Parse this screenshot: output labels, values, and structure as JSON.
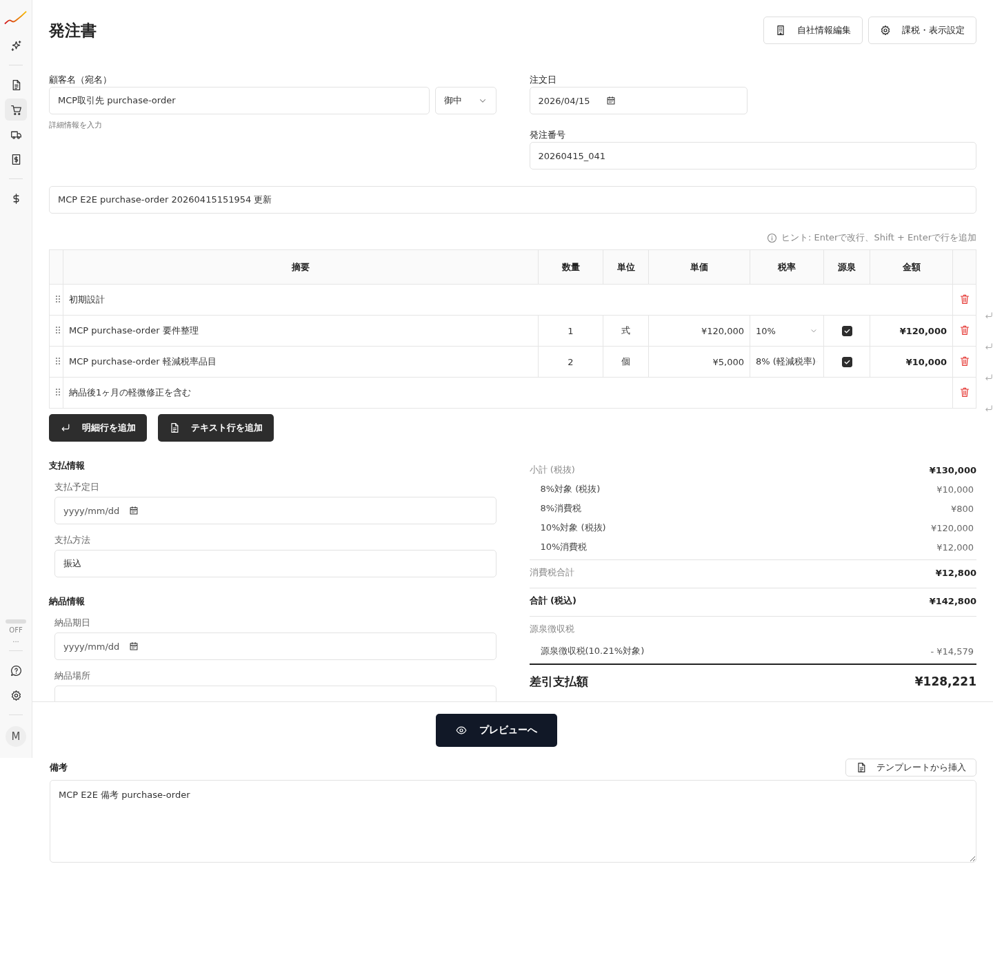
{
  "sidebar": {
    "top_items": [
      {
        "kind": "sparkle",
        "selected": false
      }
    ],
    "nav_items": [
      {
        "kind": "document",
        "selected": false
      },
      {
        "kind": "cart",
        "selected": true
      },
      {
        "kind": "truck",
        "selected": false
      },
      {
        "kind": "receipt",
        "selected": false
      }
    ],
    "extra_items": [
      {
        "kind": "dollar",
        "selected": false
      }
    ],
    "toggle": {
      "label": "OFF",
      "on": false
    },
    "more": "...",
    "bottom_items": [
      {
        "kind": "help"
      },
      {
        "kind": "settings"
      }
    ],
    "avatar": "M"
  },
  "page": {
    "title": "発注書",
    "actions": [
      {
        "kind": "building",
        "label": "自社情報編集"
      },
      {
        "kind": "gear",
        "label": "課税・表示設定"
      }
    ]
  },
  "customer": {
    "label": "顧客名（宛名）",
    "value": "MCP取引先 purchase-order",
    "honorific": "御中",
    "details_link": "詳細情報を入力"
  },
  "order_date": {
    "label": "注文日",
    "value": "2026/04/15"
  },
  "order_number": {
    "label": "発注番号",
    "value": "20260415_041"
  },
  "subject": {
    "value": "MCP E2E purchase-order 20260415151954 更新"
  },
  "hint": "ヒント: Enterで改行、Shift + Enterで行を追加",
  "table": {
    "columns": [
      "摘要",
      "数量",
      "単位",
      "単価",
      "税率",
      "源泉",
      "金額"
    ],
    "rows": [
      {
        "kind": "text",
        "description": "初期設計"
      },
      {
        "kind": "item",
        "description": "MCP purchase-order 要件整理",
        "quantity": "1",
        "unit": "式",
        "unit_price": "¥120,000",
        "tax_rate": "10%",
        "withholding": true,
        "amount": "¥120,000"
      },
      {
        "kind": "item",
        "description": "MCP purchase-order 軽減税率品目",
        "quantity": "2",
        "unit": "個",
        "unit_price": "¥5,000",
        "tax_rate": "8% (軽減税率)",
        "withholding": true,
        "amount": "¥10,000"
      },
      {
        "kind": "text",
        "description": "納品後1ヶ月の軽微修正を含む"
      }
    ]
  },
  "row_buttons": [
    {
      "kind": "return",
      "label": "明細行を追加"
    },
    {
      "kind": "document",
      "label": "テキスト行を追加"
    }
  ],
  "payment": {
    "heading": "支払情報",
    "fields": [
      {
        "kind": "date",
        "label": "支払予定日",
        "placeholder": "yyyy/mm/dd"
      },
      {
        "kind": "text",
        "label": "支払方法",
        "value": "振込"
      }
    ]
  },
  "delivery": {
    "heading": "納品情報",
    "fields": [
      {
        "kind": "date",
        "label": "納品期日",
        "placeholder": "yyyy/mm/dd"
      },
      {
        "kind": "text",
        "label": "納品場所"
      }
    ]
  },
  "summary": {
    "rows": [
      {
        "kind": "main",
        "label": "小計 (税抜)",
        "value": "¥130,000"
      },
      {
        "kind": "sub",
        "label": "8%対象 (税抜)",
        "value": "¥10,000"
      },
      {
        "kind": "sub",
        "label": "8%消費税",
        "value": "¥800"
      },
      {
        "kind": "sub",
        "label": "10%対象 (税抜)",
        "value": "¥120,000"
      },
      {
        "kind": "sub",
        "label": "10%消費税",
        "value": "¥12,000"
      },
      {
        "kind": "main_divided",
        "label": "消費税合計",
        "value": "¥12,800"
      },
      {
        "kind": "strong_divided",
        "label": "合計 (税込)",
        "value": "¥142,800"
      },
      {
        "kind": "heading_divided",
        "label": "源泉徴収税"
      },
      {
        "kind": "sub",
        "label": "源泉徴収税(10.21%対象)",
        "value": "- ¥14,579"
      }
    ],
    "total": {
      "label": "差引支払額",
      "value": "¥128,221"
    }
  },
  "footer": {
    "preview_button": "プレビューへ"
  },
  "notes": {
    "label": "備考",
    "template_button": "テンプレートから挿入",
    "value": "MCP E2E 備考 purchase-order"
  }
}
